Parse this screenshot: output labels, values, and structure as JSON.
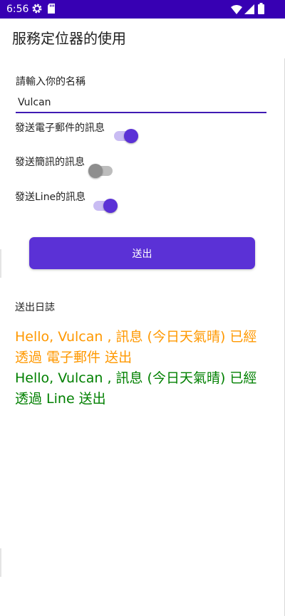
{
  "status_bar": {
    "time": "6:56",
    "icons": [
      "gear-icon",
      "sdcard-icon",
      "wifi-icon",
      "signal-icon",
      "battery-icon"
    ],
    "background": "#3700b3"
  },
  "header": {
    "title": "服務定位器的使用"
  },
  "form": {
    "name_label": "請輸入你的名稱",
    "name_value": "Vulcan",
    "toggles": [
      {
        "label": "發送電子郵件的訊息",
        "checked": true
      },
      {
        "label": "發送簡訊的訊息",
        "checked": false
      },
      {
        "label": "發送Line的訊息",
        "checked": true
      }
    ],
    "send_label": "送出"
  },
  "log": {
    "title": "送出日誌",
    "entries": [
      {
        "text": "Hello, Vulcan , 訊息 (今日天氣晴) 已經透過 電子郵件 送出",
        "color": "#ff9800"
      },
      {
        "text": "Hello, Vulcan , 訊息 (今日天氣晴) 已經透過 Line 送出",
        "color": "#008000"
      }
    ]
  },
  "theme": {
    "accent": "#5b31d6",
    "input_underline": "#3f1bb3"
  }
}
